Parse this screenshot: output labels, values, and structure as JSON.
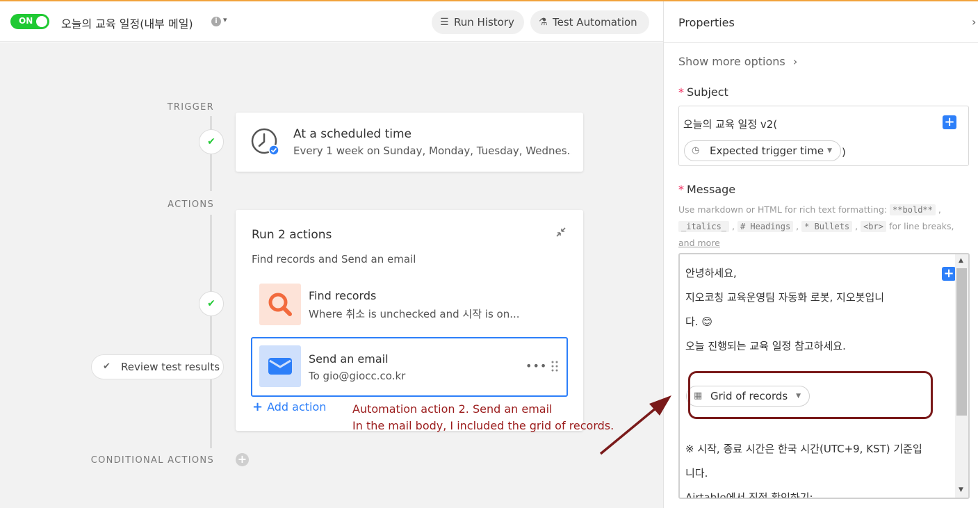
{
  "topbar": {
    "toggle_label": "ON",
    "title": "오늘의 교육 일정(내부 메일)",
    "info_glyph": "i",
    "caret_glyph": "▾",
    "run_history_label": "Run History",
    "test_automation_label": "Test Automation"
  },
  "canvas": {
    "trigger_label": "TRIGGER",
    "actions_label": "ACTIONS",
    "conditional_label": "CONDITIONAL ACTIONS",
    "review_label": "Review test results",
    "trigger_card": {
      "title": "At a scheduled time",
      "subtitle": "Every 1 week on Sunday, Monday, Tuesday, Wednes..."
    },
    "actions_card": {
      "title": "Run 2 actions",
      "subtitle": "Find records and Send an email",
      "actions": [
        {
          "title": "Find records",
          "subtitle": "Where 취소 is unchecked and 시작 is on..."
        },
        {
          "title": "Send an email",
          "subtitle": "To gio@giocc.co.kr"
        }
      ],
      "add_action_label": "Add action"
    },
    "annotation": {
      "line1": "Automation action 2. Send an email",
      "line2": "In the mail body, I included the grid of records."
    }
  },
  "panel": {
    "title": "Properties",
    "show_more_label": "Show more options",
    "subject": {
      "label": "Subject",
      "text": "오늘의 교육 일정 v2(",
      "token_label": "Expected trigger time",
      "after_token": ")"
    },
    "message": {
      "label": "Message",
      "hint_prefix": "Use markdown or HTML for rich text formatting:",
      "hint_codes": [
        "**bold**",
        "_italics_",
        "# Headings",
        "* Bullets",
        "<br>"
      ],
      "hint_suffix": "for line breaks,",
      "hint_link": "and more",
      "lines": [
        "안녕하세요,",
        "지오코칭 교육운영팀 자동화 로봇, 지오봇입니",
        "다.",
        "오늘 진행되는 교육 일정 참고하세요."
      ],
      "emoji": "😊",
      "token_label": "Grid of records",
      "lines_after": [
        "※ 시작, 종료 시간은 한국 시간(UTC+9, KST) 기준입",
        "니다.",
        "Airtable에서 직접 확인하기:"
      ]
    }
  },
  "colors": {
    "accent": "#2d7ff9",
    "toggle_on": "#20c933",
    "annotation": "#9b1c1c",
    "top_border": "#f1a33c"
  },
  "icons": {
    "run_history": "list-icon",
    "test_automation": "flask-icon",
    "trigger": "clock-icon",
    "find_records": "search-icon",
    "send_email": "envelope-icon",
    "grid": "grid-icon"
  }
}
